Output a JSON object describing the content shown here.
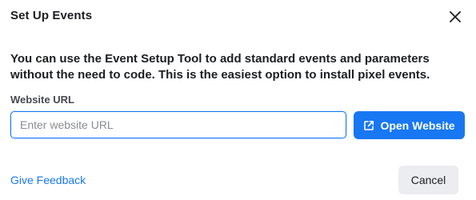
{
  "dialog": {
    "title": "Set Up Events",
    "close_icon": "close-icon",
    "description": "You can use the Event Setup Tool to add standard events and parameters without the need to code. This is the easiest option to install pixel events."
  },
  "form": {
    "website_url_label": "Website URL",
    "website_url_placeholder": "Enter website URL",
    "website_url_value": "",
    "open_website_label": "Open Website",
    "open_website_icon": "external-link-icon"
  },
  "footer": {
    "feedback_label": "Give Feedback",
    "cancel_label": "Cancel"
  },
  "colors": {
    "accent": "#1877f2",
    "text": "#1c1e21",
    "secondary_button_bg": "#ebedf0",
    "placeholder": "#8a8d91"
  }
}
